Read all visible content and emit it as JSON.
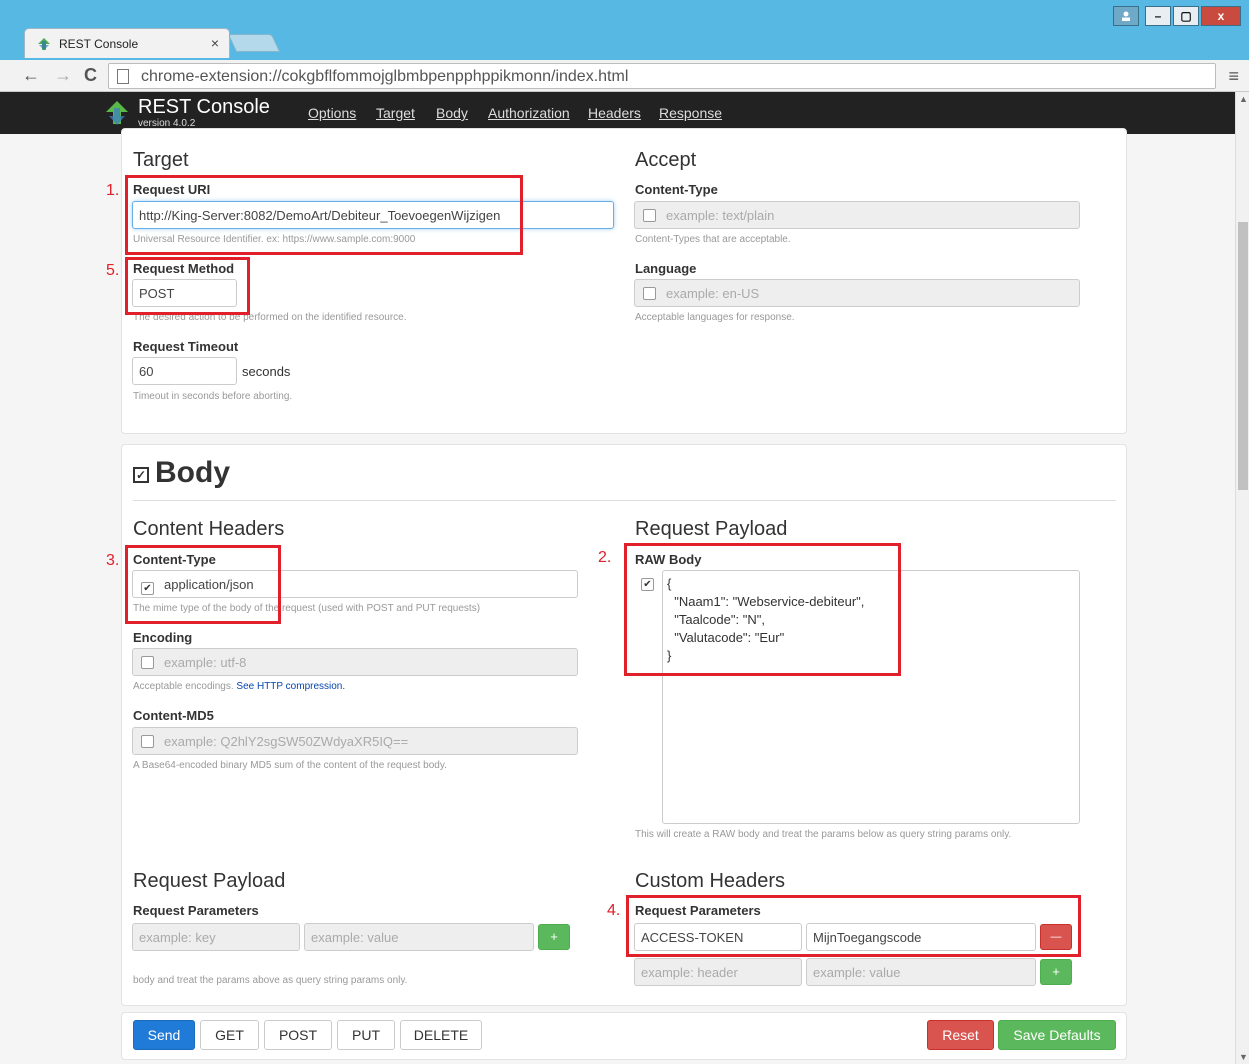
{
  "browser": {
    "tab_title": "REST Console",
    "tab_close": "×",
    "url": "chrome-extension://cokgbflfommojglbmbpenpphppikmonn/index.html",
    "window_buttons": [
      "–",
      "▢",
      "x"
    ]
  },
  "app": {
    "brand": "REST Console",
    "version": "version 4.0.2",
    "nav": [
      "Options",
      "Target",
      "Body",
      "Authorization",
      "Headers",
      "Response"
    ]
  },
  "target": {
    "title": "Target",
    "request_uri_label": "Request URI",
    "request_uri_value": "http://King-Server:8082/DemoArt/Debiteur_ToevoegenWijzigen",
    "request_uri_help": "Universal Resource Identifier. ex: https://www.sample.com:9000",
    "request_method_label": "Request Method",
    "request_method_value": "POST",
    "request_method_help": "The desired action to be performed on the identified resource.",
    "request_timeout_label": "Request Timeout",
    "request_timeout_value": "60",
    "request_timeout_unit": "seconds",
    "request_timeout_help": "Timeout in seconds before aborting."
  },
  "accept": {
    "title": "Accept",
    "content_type_label": "Content-Type",
    "content_type_placeholder": "example: text/plain",
    "content_type_help": "Content-Types that are acceptable.",
    "language_label": "Language",
    "language_placeholder": "example: en-US",
    "language_help": "Acceptable languages for response."
  },
  "body": {
    "title": "Body",
    "content_headers_title": "Content Headers",
    "content_type_label": "Content-Type",
    "content_type_value": "application/json",
    "content_type_help": "The mime type of the body of the request (used with POST and PUT requests)",
    "encoding_label": "Encoding",
    "encoding_placeholder": "example: utf-8",
    "encoding_help": "Acceptable encodings.",
    "encoding_link": "See HTTP compression.",
    "md5_label": "Content-MD5",
    "md5_placeholder": "example: Q2hlY2sgSW50ZWdyaXR5IQ==",
    "md5_help": "A Base64-encoded binary MD5 sum of the content of the request body.",
    "payload_title": "Request Payload",
    "raw_body_label": "RAW Body",
    "raw_body_lines": [
      "{",
      "  \"Naam1\": \"Webservice-debiteur\",",
      "  \"Taalcode\": \"N\",",
      "  \"Valutacode\": \"Eur\"",
      "}"
    ],
    "raw_body_help": "This will create a RAW body and treat the params below as query string params only.",
    "params_title": "Request Payload",
    "params_label": "Request Parameters",
    "params_key_placeholder": "example: key",
    "params_value_placeholder": "example: value",
    "params_help": "body and treat the params above as query string params only.",
    "custom_headers_title": "Custom Headers",
    "custom_params_label": "Request Parameters",
    "custom_key_value": "ACCESS-TOKEN",
    "custom_value_value": "MijnToegangscode",
    "custom_key_placeholder": "example: header",
    "custom_value_placeholder": "example: value"
  },
  "actions": {
    "send": "Send",
    "get": "GET",
    "post": "POST",
    "put": "PUT",
    "delete": "DELETE",
    "reset": "Reset",
    "save_defaults": "Save Defaults",
    "add": "+",
    "remove": "—"
  },
  "annotations": [
    "1.",
    "2.",
    "3.",
    "4.",
    "5."
  ],
  "colors": {
    "annotation": "#e0202a",
    "navbar": "#222222",
    "primary": "#1f7ad8",
    "danger": "#d9534f",
    "success": "#5cb85c"
  }
}
